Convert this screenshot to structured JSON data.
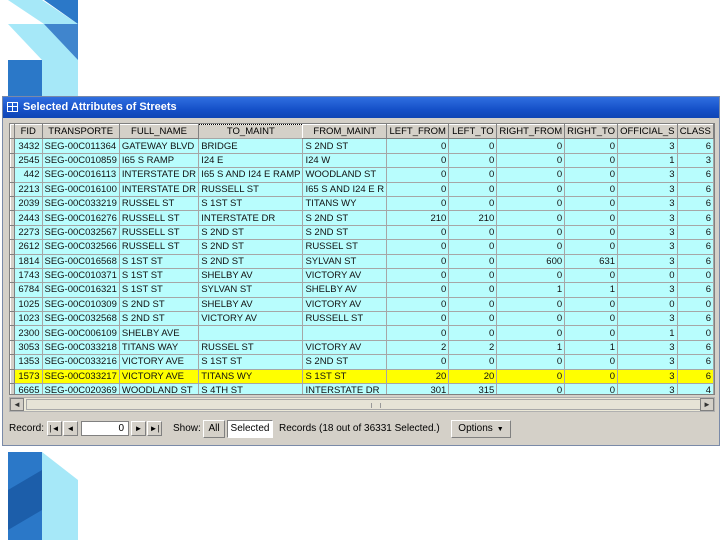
{
  "window": {
    "title": "Selected Attributes of Streets"
  },
  "table": {
    "columns": [
      "FID",
      "TRANSPORTE",
      "FULL_NAME",
      "TO_MAINT",
      "FROM_MAINT",
      "LEFT_FROM",
      "LEFT_TO",
      "RIGHT_FROM",
      "RIGHT_TO",
      "OFFICIAL_S",
      "CLASS"
    ],
    "rows": [
      [
        "3432",
        "SEG-00C011364",
        "GATEWAY BLVD",
        "BRIDGE",
        "S 2ND ST",
        "0",
        "0",
        "0",
        "0",
        "3",
        "6"
      ],
      [
        "2545",
        "SEG-00C010859",
        "I65 S RAMP",
        "I24 E",
        "I24 W",
        "0",
        "0",
        "0",
        "0",
        "1",
        "3"
      ],
      [
        "442",
        "SEG-00C016113",
        "INTERSTATE DR",
        "I65 S AND I24 E RAMP",
        "WOODLAND ST",
        "0",
        "0",
        "0",
        "0",
        "3",
        "6"
      ],
      [
        "2213",
        "SEG-00C016100",
        "INTERSTATE DR",
        "RUSSELL ST",
        "I65 S AND I24 E R",
        "0",
        "0",
        "0",
        "0",
        "3",
        "6"
      ],
      [
        "2039",
        "SEG-00C033219",
        "RUSSEL ST",
        "S 1ST ST",
        "TITANS WY",
        "0",
        "0",
        "0",
        "0",
        "3",
        "6"
      ],
      [
        "2443",
        "SEG-00C016276",
        "RUSSELL ST",
        "INTERSTATE DR",
        "S 2ND ST",
        "210",
        "210",
        "0",
        "0",
        "3",
        "6"
      ],
      [
        "2273",
        "SEG-00C032567",
        "RUSSELL ST",
        "S 2ND ST",
        "S 2ND ST",
        "0",
        "0",
        "0",
        "0",
        "3",
        "6"
      ],
      [
        "2612",
        "SEG-00C032566",
        "RUSSELL ST",
        "S 2ND ST",
        "RUSSEL ST",
        "0",
        "0",
        "0",
        "0",
        "3",
        "6"
      ],
      [
        "1814",
        "SEG-00C016568",
        "S 1ST ST",
        "S 2ND ST",
        "SYLVAN ST",
        "0",
        "0",
        "600",
        "631",
        "3",
        "6"
      ],
      [
        "1743",
        "SEG-00C010371",
        "S 1ST ST",
        "SHELBY AV",
        "VICTORY AV",
        "0",
        "0",
        "0",
        "0",
        "0",
        "0"
      ],
      [
        "6784",
        "SEG-00C016321",
        "S 1ST ST",
        "SYLVAN ST",
        "SHELBY AV",
        "0",
        "0",
        "1",
        "1",
        "3",
        "6"
      ],
      [
        "1025",
        "SEG-00C010309",
        "S 2ND ST",
        "SHELBY AV",
        "VICTORY AV",
        "0",
        "0",
        "0",
        "0",
        "0",
        "0"
      ],
      [
        "1023",
        "SEG-00C032568",
        "S 2ND ST",
        "VICTORY AV",
        "RUSSELL ST",
        "0",
        "0",
        "0",
        "0",
        "3",
        "6"
      ],
      [
        "2300",
        "SEG-00C006109",
        "SHELBY AVE",
        "",
        "",
        "0",
        "0",
        "0",
        "0",
        "1",
        "0"
      ],
      [
        "3053",
        "SEG-00C033218",
        "TITANS WAY",
        "RUSSEL ST",
        "VICTORY AV",
        "2",
        "2",
        "1",
        "1",
        "3",
        "6"
      ],
      [
        "1353",
        "SEG-00C033216",
        "VICTORY AVE",
        "S 1ST ST",
        "S 2ND ST",
        "0",
        "0",
        "0",
        "0",
        "3",
        "6"
      ],
      [
        "1573",
        "SEG-00C033217",
        "VICTORY AVE",
        "TITANS WY",
        "S 1ST ST",
        "20",
        "20",
        "0",
        "0",
        "3",
        "6"
      ],
      [
        "6665",
        "SEG-00C020369",
        "WOODLAND ST",
        "S 4TH ST",
        "INTERSTATE DR",
        "301",
        "315",
        "0",
        "0",
        "3",
        "4"
      ]
    ]
  },
  "footer": {
    "record_label": "Record:",
    "record_value": "0",
    "nav_first": "|◄",
    "nav_prev": "◄",
    "nav_next": "►",
    "nav_last": "►|",
    "show_label": "Show:",
    "all_label": "All",
    "selected_label": "Selected",
    "records_text": "Records (18 out of 36331 Selected.)",
    "options_label": "Options"
  },
  "colors": {
    "titlebar": "#1550c8",
    "cell_bg": "#b8fdfd",
    "highlight_row": "#ffff00",
    "deco_blue": "#2b78c8",
    "deco_cyan": "#a6e8f8"
  }
}
